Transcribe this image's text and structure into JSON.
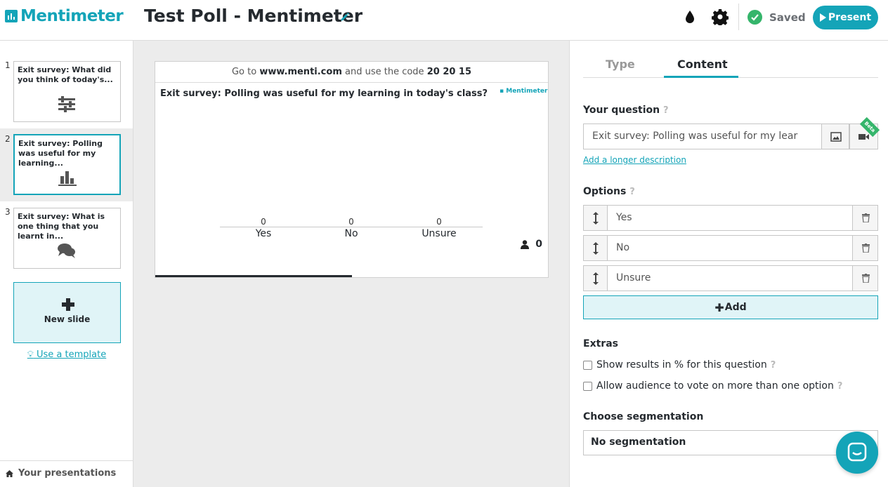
{
  "header": {
    "logo_text": "Mentimeter",
    "title": "Test Poll - Mentimeter",
    "saved_label": "Saved",
    "present_label": "Present",
    "accent_color": "#14a4b8"
  },
  "sidebar": {
    "slides": [
      {
        "number": "1",
        "title": "Exit survey: What did you think of today's...",
        "icon": "sliders-icon"
      },
      {
        "number": "2",
        "title": "Exit survey: Polling was useful for my learning...",
        "icon": "bar-chart-icon"
      },
      {
        "number": "3",
        "title": "Exit survey: What is one thing that you learnt in...",
        "icon": "speech-bubbles-icon"
      }
    ],
    "new_slide_label": "New slide",
    "template_link": "Use a template",
    "your_presentations": "Your presentations"
  },
  "preview": {
    "code_prefix": "Go to",
    "code_url": "www.menti.com",
    "code_middle": "and use the code",
    "code": "20 20 15",
    "question": "Exit survey: Polling was useful for my learning in today's class?",
    "brand": "Mentimeter",
    "options": [
      {
        "label": "Yes",
        "value": "0"
      },
      {
        "label": "No",
        "value": "0"
      },
      {
        "label": "Unsure",
        "value": "0"
      }
    ],
    "participant_count": "0"
  },
  "panel": {
    "tabs": {
      "type": "Type",
      "content": "Content"
    },
    "your_question_label": "Your question",
    "question_value": "Exit survey: Polling was useful for my lear",
    "beta_label": "Beta",
    "longer_description": "Add a longer description",
    "options_label": "Options",
    "options": [
      "Yes",
      "No",
      "Unsure"
    ],
    "add_label": "Add",
    "extras_label": "Extras",
    "extras": [
      "Show results in % for this question",
      "Allow audience to vote on more than one option"
    ],
    "segmentation_label": "Choose segmentation",
    "segmentation_value": "No segmentation",
    "help_mark": "?"
  }
}
